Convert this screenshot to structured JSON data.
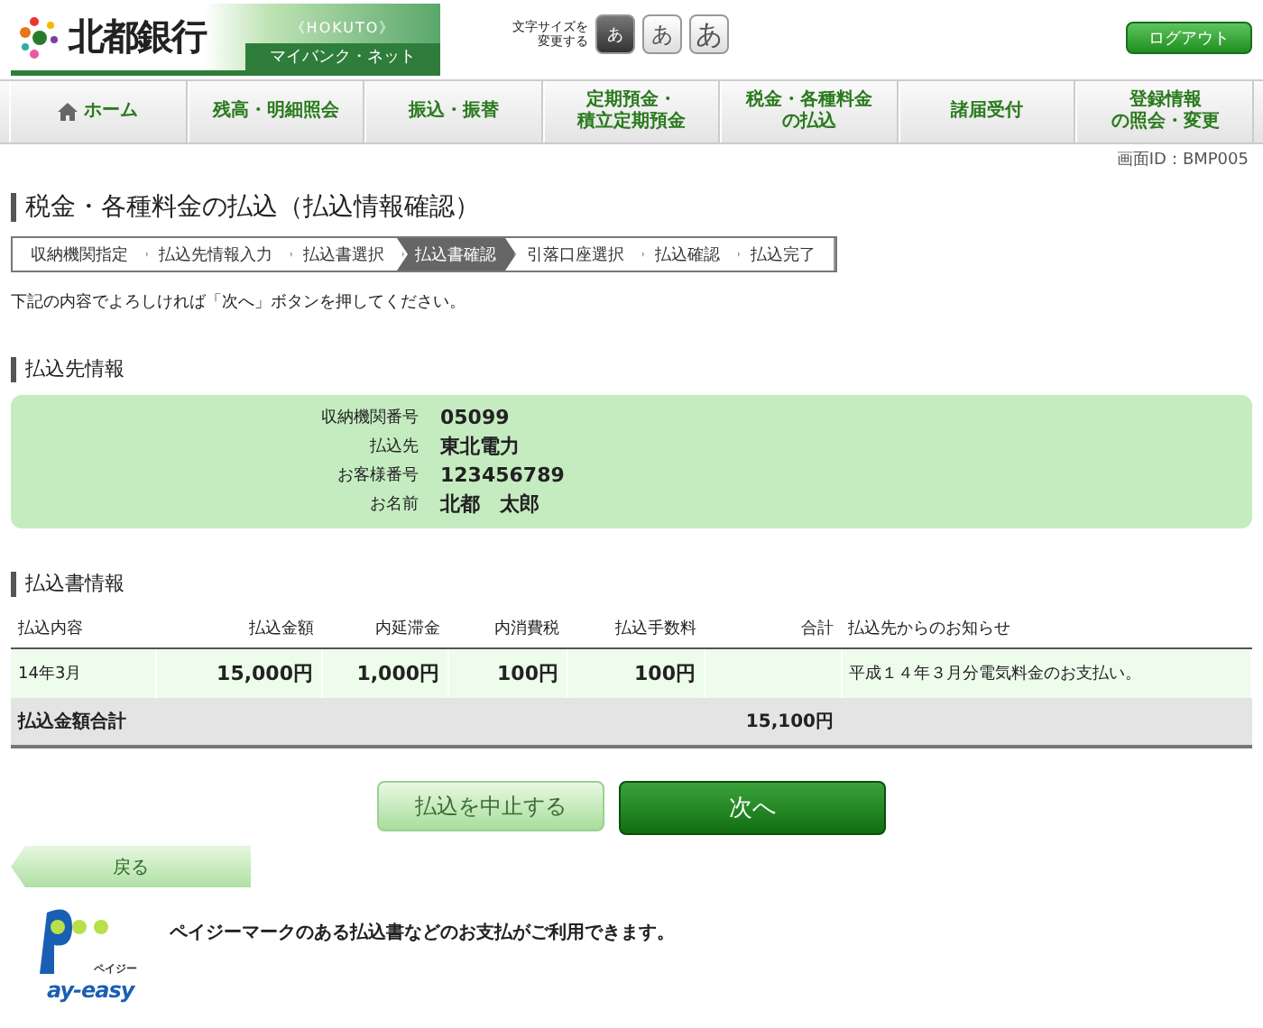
{
  "header": {
    "bank_name": "北都銀行",
    "tagline": "《HOKUTO》",
    "service_name": "マイバンク・ネット",
    "font_size_label": [
      "文字サイズを",
      "変更する"
    ],
    "font_sizes": [
      {
        "label": "あ",
        "selected": true
      },
      {
        "label": "あ",
        "selected": false
      },
      {
        "label": "あ",
        "selected": false
      }
    ],
    "logout": "ログアウト"
  },
  "nav": [
    {
      "kind": "home",
      "lines": [
        "ホーム"
      ]
    },
    {
      "kind": "plain",
      "lines": [
        "残高・明細照会"
      ]
    },
    {
      "kind": "plain",
      "lines": [
        "振込・振替"
      ]
    },
    {
      "kind": "plain",
      "lines": [
        "定期預金・",
        "積立定期預金"
      ]
    },
    {
      "kind": "plain",
      "lines": [
        "税金・各種料金",
        "の払込"
      ]
    },
    {
      "kind": "plain",
      "lines": [
        "諸届受付"
      ]
    },
    {
      "kind": "plain",
      "lines": [
        "登録情報",
        "の照会・変更"
      ]
    }
  ],
  "screen_id": "画面ID：BMP005",
  "page_title": "税金・各種料金の払込（払込情報確認）",
  "steps": [
    {
      "label": "収納機関指定",
      "selected": false
    },
    {
      "label": "払込先情報入力",
      "selected": false
    },
    {
      "label": "払込書選択",
      "selected": false
    },
    {
      "label": "払込書確認",
      "selected": true
    },
    {
      "label": "引落口座選択",
      "selected": false
    },
    {
      "label": "払込確認",
      "selected": false
    },
    {
      "label": "払込完了",
      "selected": false
    }
  ],
  "instruction": "下記の内容でよろしければ「次へ」ボタンを押してください。",
  "payee_section": {
    "heading": "払込先情報",
    "fields": [
      {
        "label": "収納機関番号",
        "value": "05099"
      },
      {
        "label": "払込先",
        "value": "東北電力"
      },
      {
        "label": "お客様番号",
        "value": "123456789"
      },
      {
        "label": "お名前",
        "value": "北都　太郎"
      }
    ]
  },
  "bill_section": {
    "heading": "払込書情報",
    "columns": [
      "払込内容",
      "払込金額",
      "内延滞金",
      "内消費税",
      "払込手数料",
      "合計",
      "払込先からのお知らせ"
    ],
    "rows": [
      [
        "14年3月",
        "15,000円",
        "1,000円",
        "100円",
        "100円",
        "",
        "平成１４年３月分電気料金のお支払い。"
      ]
    ],
    "total": {
      "label": "払込金額合計",
      "amount": "15,100円"
    }
  },
  "buttons": {
    "cancel": "払込を中止する",
    "next": "次へ",
    "back": "戻る"
  },
  "payeasy": {
    "logo_ruby": "ペイジー",
    "logo_text": "ay-easy",
    "message": "ペイジーマークのある払込書などのお支払がご利用できます。"
  }
}
